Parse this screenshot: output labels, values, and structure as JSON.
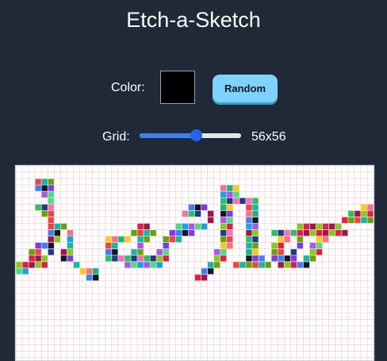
{
  "app": {
    "title": "Etch-a-Sketch"
  },
  "controls": {
    "color_label": "Color:",
    "color_value": "#000000",
    "random_label": "Random",
    "grid_label": "Grid:",
    "grid_size": 56,
    "grid_size_text": "56x56",
    "slider_min": 2,
    "slider_max": 100
  },
  "board": {
    "cells_across": 56,
    "grid_line_color": "#f1d4d8",
    "background": "#ffffff",
    "visible_rows": 30,
    "drawn_text": "hello",
    "palette": [
      "#22c55e",
      "#e11d48",
      "#a855f7",
      "#3b82f6",
      "#facc15",
      "#14b8a6",
      "#f472b6",
      "#84cc16",
      "#0ea5e9",
      "#7c3aed",
      "#10b981",
      "#ef4444",
      "#1e3a8a",
      "#9d174d",
      "#4ade80",
      "#0f172a",
      "#fb7185",
      "#65a30d"
    ],
    "painted": [
      [
        3,
        2
      ],
      [
        4,
        2
      ],
      [
        5,
        2
      ],
      [
        3,
        3
      ],
      [
        4,
        3
      ],
      [
        5,
        3
      ],
      [
        4,
        4
      ],
      [
        5,
        4
      ],
      [
        5,
        5
      ],
      [
        3,
        6
      ],
      [
        4,
        6
      ],
      [
        5,
        6
      ],
      [
        4,
        7
      ],
      [
        5,
        7
      ],
      [
        5,
        8
      ],
      [
        5,
        9
      ],
      [
        6,
        9
      ],
      [
        7,
        9
      ],
      [
        5,
        10
      ],
      [
        6,
        10
      ],
      [
        8,
        10
      ],
      [
        5,
        11
      ],
      [
        6,
        11
      ],
      [
        8,
        11
      ],
      [
        3,
        12
      ],
      [
        4,
        12
      ],
      [
        5,
        12
      ],
      [
        8,
        12
      ],
      [
        2,
        13
      ],
      [
        3,
        13
      ],
      [
        5,
        13
      ],
      [
        7,
        13
      ],
      [
        8,
        13
      ],
      [
        2,
        14
      ],
      [
        3,
        14
      ],
      [
        4,
        14
      ],
      [
        7,
        14
      ],
      [
        8,
        14
      ],
      [
        0,
        15
      ],
      [
        1,
        15
      ],
      [
        2,
        15
      ],
      [
        3,
        15
      ],
      [
        4,
        15
      ],
      [
        9,
        15
      ],
      [
        0,
        16
      ],
      [
        1,
        16
      ],
      [
        10,
        16
      ],
      [
        11,
        16
      ],
      [
        12,
        16
      ],
      [
        11,
        17
      ],
      [
        12,
        17
      ],
      [
        19,
        9
      ],
      [
        20,
        9
      ],
      [
        18,
        10
      ],
      [
        19,
        10
      ],
      [
        20,
        10
      ],
      [
        21,
        10
      ],
      [
        14,
        11
      ],
      [
        15,
        11
      ],
      [
        16,
        11
      ],
      [
        17,
        11
      ],
      [
        19,
        11
      ],
      [
        20,
        11
      ],
      [
        14,
        12
      ],
      [
        15,
        12
      ],
      [
        19,
        12
      ],
      [
        14,
        13
      ],
      [
        15,
        13
      ],
      [
        18,
        13
      ],
      [
        19,
        13
      ],
      [
        14,
        14
      ],
      [
        15,
        14
      ],
      [
        16,
        14
      ],
      [
        17,
        14
      ],
      [
        18,
        14
      ],
      [
        19,
        14
      ],
      [
        20,
        14
      ],
      [
        21,
        14
      ],
      [
        17,
        15
      ],
      [
        18,
        15
      ],
      [
        19,
        15
      ],
      [
        20,
        15
      ],
      [
        21,
        15
      ],
      [
        22,
        15
      ],
      [
        27,
        6
      ],
      [
        28,
        6
      ],
      [
        29,
        6
      ],
      [
        26,
        7
      ],
      [
        27,
        7
      ],
      [
        28,
        7
      ],
      [
        30,
        7
      ],
      [
        30,
        8
      ],
      [
        25,
        9
      ],
      [
        26,
        9
      ],
      [
        27,
        9
      ],
      [
        28,
        9
      ],
      [
        29,
        9
      ],
      [
        24,
        10
      ],
      [
        25,
        10
      ],
      [
        26,
        10
      ],
      [
        27,
        10
      ],
      [
        23,
        11
      ],
      [
        24,
        11
      ],
      [
        25,
        11
      ],
      [
        23,
        12
      ],
      [
        22,
        13
      ],
      [
        23,
        13
      ],
      [
        22,
        14
      ],
      [
        23,
        14
      ],
      [
        32,
        3
      ],
      [
        33,
        3
      ],
      [
        34,
        3
      ],
      [
        32,
        4
      ],
      [
        33,
        4
      ],
      [
        34,
        4
      ],
      [
        32,
        5
      ],
      [
        33,
        5
      ],
      [
        34,
        5
      ],
      [
        32,
        6
      ],
      [
        33,
        6
      ],
      [
        32,
        7
      ],
      [
        33,
        7
      ],
      [
        32,
        8
      ],
      [
        33,
        8
      ],
      [
        32,
        9
      ],
      [
        33,
        9
      ],
      [
        32,
        10
      ],
      [
        33,
        10
      ],
      [
        32,
        11
      ],
      [
        33,
        11
      ],
      [
        32,
        12
      ],
      [
        33,
        12
      ],
      [
        31,
        13
      ],
      [
        32,
        13
      ],
      [
        31,
        14
      ],
      [
        32,
        14
      ],
      [
        30,
        15
      ],
      [
        31,
        15
      ],
      [
        29,
        16
      ],
      [
        30,
        16
      ],
      [
        28,
        17
      ],
      [
        29,
        17
      ],
      [
        35,
        5
      ],
      [
        36,
        5
      ],
      [
        37,
        5
      ],
      [
        36,
        6
      ],
      [
        37,
        6
      ],
      [
        36,
        7
      ],
      [
        37,
        7
      ],
      [
        36,
        8
      ],
      [
        37,
        8
      ],
      [
        36,
        9
      ],
      [
        37,
        9
      ],
      [
        36,
        10
      ],
      [
        37,
        10
      ],
      [
        36,
        11
      ],
      [
        37,
        11
      ],
      [
        36,
        12
      ],
      [
        37,
        12
      ],
      [
        36,
        13
      ],
      [
        37,
        13
      ],
      [
        36,
        14
      ],
      [
        37,
        14
      ],
      [
        38,
        14
      ],
      [
        34,
        15
      ],
      [
        35,
        15
      ],
      [
        36,
        15
      ],
      [
        37,
        15
      ],
      [
        38,
        15
      ],
      [
        39,
        15
      ],
      [
        40,
        10
      ],
      [
        41,
        10
      ],
      [
        42,
        10
      ],
      [
        43,
        10
      ],
      [
        41,
        11
      ],
      [
        42,
        11
      ],
      [
        44,
        11
      ],
      [
        40,
        12
      ],
      [
        41,
        12
      ],
      [
        44,
        12
      ],
      [
        40,
        13
      ],
      [
        41,
        13
      ],
      [
        43,
        13
      ],
      [
        40,
        14
      ],
      [
        41,
        14
      ],
      [
        42,
        14
      ],
      [
        43,
        14
      ],
      [
        41,
        15
      ],
      [
        42,
        15
      ],
      [
        43,
        15
      ],
      [
        44,
        9
      ],
      [
        45,
        9
      ],
      [
        46,
        9
      ],
      [
        47,
        9
      ],
      [
        48,
        9
      ],
      [
        49,
        9
      ],
      [
        50,
        9
      ],
      [
        44,
        10
      ],
      [
        45,
        10
      ],
      [
        46,
        10
      ],
      [
        47,
        10
      ],
      [
        48,
        10
      ],
      [
        49,
        10
      ],
      [
        50,
        10
      ],
      [
        51,
        10
      ],
      [
        52,
        8
      ],
      [
        53,
        8
      ],
      [
        54,
        8
      ],
      [
        55,
        8
      ],
      [
        53,
        7
      ],
      [
        54,
        7
      ],
      [
        55,
        7
      ],
      [
        54,
        6
      ],
      [
        55,
        6
      ],
      [
        51,
        8
      ],
      [
        52,
        7
      ],
      [
        47,
        11
      ],
      [
        48,
        11
      ],
      [
        46,
        12
      ],
      [
        47,
        12
      ],
      [
        46,
        13
      ],
      [
        47,
        13
      ],
      [
        45,
        14
      ],
      [
        46,
        14
      ],
      [
        44,
        15
      ],
      [
        45,
        15
      ]
    ]
  }
}
